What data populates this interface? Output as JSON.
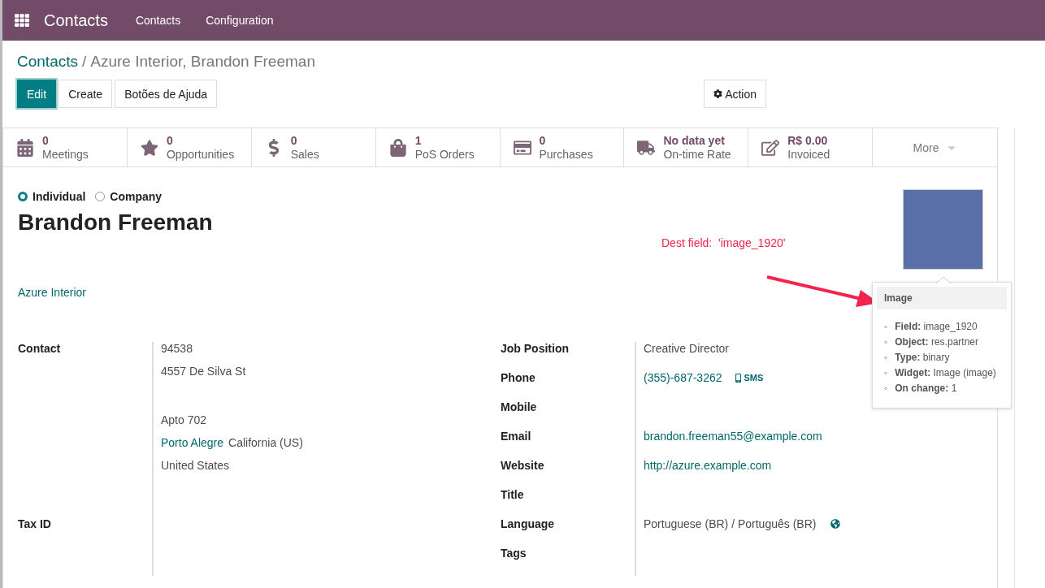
{
  "navbar": {
    "app": "Contacts",
    "menu": [
      "Contacts",
      "Configuration"
    ]
  },
  "breadcrumb": {
    "parent": "Contacts",
    "separator": "/",
    "current": "Azure Interior, Brandon Freeman"
  },
  "buttons": [
    {
      "label": "Edit",
      "kind": "primary"
    },
    {
      "label": "Create",
      "kind": "secondary"
    },
    {
      "label": "Botões de Ajuda",
      "kind": "secondary"
    }
  ],
  "action_button": "Action",
  "stats": [
    {
      "value": "0",
      "label": "Meetings"
    },
    {
      "value": "0",
      "label": "Opportunities"
    },
    {
      "value": "0",
      "label": "Sales"
    },
    {
      "value": "1",
      "label": "PoS Orders"
    },
    {
      "value": "0",
      "label": "Purchases"
    },
    {
      "value": "No data yet",
      "label": "On-time Rate"
    },
    {
      "value": "R$ 0.00",
      "label": "Invoiced"
    }
  ],
  "more_button": "More",
  "company_type": [
    {
      "label": "Individual",
      "selected": true
    },
    {
      "label": "Company",
      "selected": false
    }
  ],
  "name": "Brandon Freeman",
  "company": "Azure Interior",
  "annotation": "Dest field:  'image_1920'",
  "tooltip": {
    "title": "Image",
    "marker": "◦",
    "items": [
      {
        "key": "Field:",
        "value": "image_1920"
      },
      {
        "key": "Object:",
        "value": "res.partner"
      },
      {
        "key": "Type:",
        "value": "binary"
      },
      {
        "key": "Widget:",
        "value": "Image (image)"
      },
      {
        "key": "On change:",
        "value": "1"
      }
    ]
  },
  "left_fields": [
    {
      "label": "Contact",
      "kind": "address",
      "lines": [
        {
          "parts": [
            {
              "text": "94538",
              "link": false
            }
          ],
          "gap_before": false
        },
        {
          "parts": [
            {
              "text": "4557 De Silva St",
              "link": false
            }
          ],
          "gap_before": false
        },
        {
          "parts": [
            {
              "text": "Apto 702",
              "link": false
            }
          ],
          "gap_before": true
        },
        {
          "parts": [
            {
              "text": "Porto Alegre",
              "link": true
            },
            {
              "text": "California (US)",
              "link": false
            }
          ],
          "gap_before": false
        },
        {
          "parts": [
            {
              "text": "United States",
              "link": false
            }
          ],
          "gap_before": false
        }
      ]
    },
    {
      "label": "Tax ID",
      "kind": "empty"
    }
  ],
  "right_fields": [
    {
      "label": "Job Position",
      "kind": "text",
      "value": "Creative Director"
    },
    {
      "label": "Phone",
      "kind": "phone",
      "value": "(355)-687-3262",
      "extra": "SMS"
    },
    {
      "label": "Mobile",
      "kind": "empty"
    },
    {
      "label": "Email",
      "kind": "link",
      "value": "brandon.freeman55@example.com"
    },
    {
      "label": "Website",
      "kind": "link",
      "value": "http://azure.example.com"
    },
    {
      "label": "Title",
      "kind": "empty"
    },
    {
      "label": "Language",
      "kind": "language",
      "value": "Portuguese (BR) / Português (BR)"
    },
    {
      "label": "Tags",
      "kind": "empty"
    }
  ]
}
